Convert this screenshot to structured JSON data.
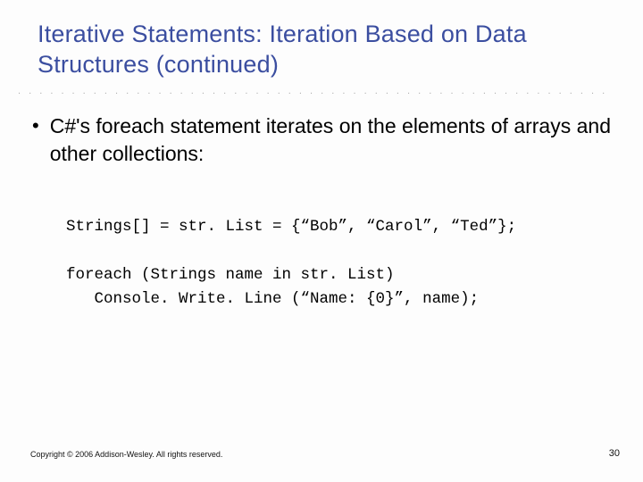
{
  "title": "Iterative Statements: Iteration Based on Data Structures (continued)",
  "bullet": "C#'s foreach statement iterates on the elements of arrays and other collections:",
  "code": {
    "line1": "Strings[] = str. List = {“Bob”, “Carol”, “Ted”};",
    "line2": "foreach (Strings name in str. List)",
    "line3": "   Console. Write. Line (“Name: {0}”, name);"
  },
  "footer": "Copyright © 2006 Addison-Wesley. All rights reserved.",
  "pagenum": "30"
}
